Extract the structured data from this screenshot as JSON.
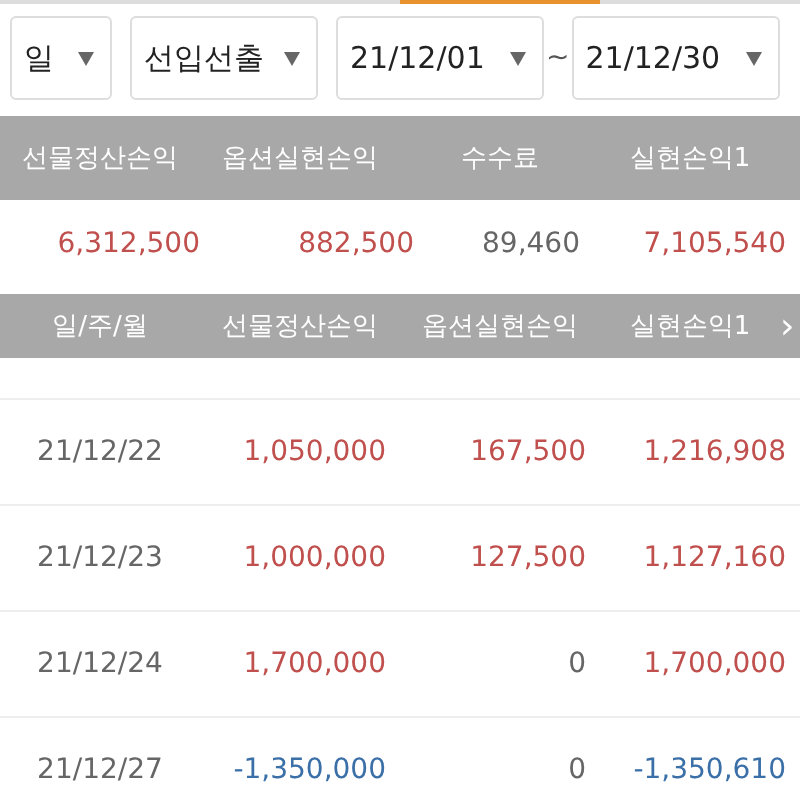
{
  "filters": {
    "period": "일",
    "method": "선입선출",
    "date_from": "21/12/01",
    "separator": "~",
    "date_to": "21/12/30"
  },
  "summary": {
    "columns": [
      "선물정산손익",
      "옵션실현손익",
      "수수료",
      "실현손익1"
    ],
    "values": [
      {
        "text": "6,312,500",
        "kind": "gain"
      },
      {
        "text": "882,500",
        "kind": "gain"
      },
      {
        "text": "89,460",
        "kind": "neutral"
      },
      {
        "text": "7,105,540",
        "kind": "gain"
      }
    ]
  },
  "table": {
    "columns": [
      "일/주/월",
      "선물정산손익",
      "옵션실현손익",
      "실현손익1"
    ],
    "more": "›",
    "rows": [
      {
        "cells": [
          {
            "text": "21/12/22",
            "kind": "neutral"
          },
          {
            "text": "1,050,000",
            "kind": "gain"
          },
          {
            "text": "167,500",
            "kind": "gain"
          },
          {
            "text": "1,216,908",
            "kind": "gain"
          }
        ]
      },
      {
        "cells": [
          {
            "text": "21/12/23",
            "kind": "neutral"
          },
          {
            "text": "1,000,000",
            "kind": "gain"
          },
          {
            "text": "127,500",
            "kind": "gain"
          },
          {
            "text": "1,127,160",
            "kind": "gain"
          }
        ]
      },
      {
        "cells": [
          {
            "text": "21/12/24",
            "kind": "neutral"
          },
          {
            "text": "1,700,000",
            "kind": "gain"
          },
          {
            "text": "0",
            "kind": "neutral"
          },
          {
            "text": "1,700,000",
            "kind": "gain"
          }
        ]
      },
      {
        "cells": [
          {
            "text": "21/12/27",
            "kind": "neutral"
          },
          {
            "text": "-1,350,000",
            "kind": "loss"
          },
          {
            "text": "0",
            "kind": "neutral"
          },
          {
            "text": "-1,350,610",
            "kind": "loss"
          }
        ]
      }
    ]
  }
}
